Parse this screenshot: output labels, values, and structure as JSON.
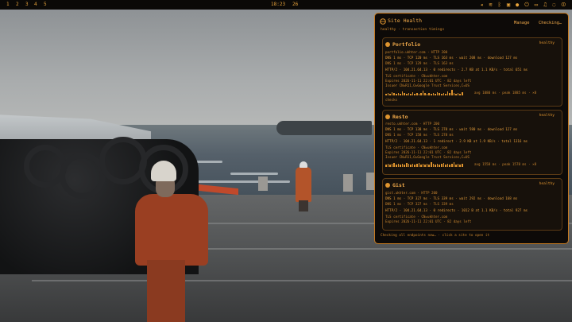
{
  "topbar": {
    "workspaces": [
      "1",
      "2",
      "3",
      "4",
      "5"
    ],
    "clock": "18:23",
    "calendar": "26",
    "tray_icons": [
      "volume-icon",
      "wifi-icon",
      "bluetooth-icon",
      "lock-icon",
      "globe-icon",
      "power-icon",
      "battery-icon",
      "headphones-icon",
      "chat-icon",
      "power-off-icon"
    ]
  },
  "panel": {
    "title": "Site Health",
    "subtitle": "healthy · transaction timings",
    "manage_label": "Manage",
    "checking_label": "Checking…",
    "footer": "Checking all endpoints now… · click a site to open it",
    "sites": [
      {
        "name": "Portfolio",
        "status": "healthy",
        "lines": [
          "portfolio.ukhter.com · HTTP 200",
          "DNS 1 ms · TCP 120 ms · TLS 163 ms · wait 208 ms · download 127 ms",
          "DNS 1 ms · TCP 129 ms · TLS 163 ms",
          "HTTP/2 · 104.21.64.13 · 0 redirects · 2.7 KB at 1.1 KB/s · total 651 ms",
          "TLS certificate · CN=ukhter.com",
          "Expires 2026-11-11 22:01 UTC · 82 days left",
          "Issuer CN=R11,O=Google Trust Services,C=US"
        ],
        "spark_text": "avg 1080 ms · peak 1885 ms · ×8",
        "checks": "checks"
      },
      {
        "name": "Resto",
        "status": "healthy",
        "lines": [
          "resto.ukhter.com · HTTP 200",
          "DNS 1 ms · TCP 138 ms · TLS 278 ms · wait 580 ms · download 127 ms",
          "DNS 1 ms · TCP 158 ms · TLS 278 ms",
          "HTTP/2 · 104.21.64.13 · 1 redirect · 2.9 KB at 1.9 KB/s · total 1316 ms",
          "TLS certificate · CN=ukhter.com",
          "Expires 2026-11-11 22:01 UTC · 82 days left",
          "Issuer CN=R11,O=Google Trust Services,C=US"
        ],
        "spark_text": "avg 1558 ms · peak 1578 ms · ×8",
        "checks": ""
      },
      {
        "name": "Gist",
        "status": "healthy",
        "lines": [
          "gist.ukhter.com · HTTP 200",
          "DNS 1 ms · TCP 327 ms · TLS 339 ms · wait 292 ms · download 168 ms",
          "DNS 1 ms · TCP 327 ms · TLS 339 ms",
          "HTTP/2 · 104.21.64.13 · 0 redirects · 1012 B at 1.1 KB/s · total 927 ms",
          "TLS certificate · CN=ukhter.com",
          "Expires 2026-11-11 22:01 UTC · 82 days left"
        ],
        "spark_text": "",
        "checks": ""
      }
    ]
  },
  "colors": {
    "accent": "#e0952f",
    "panel_bg": "#0d0a08",
    "border": "#c77a20"
  }
}
